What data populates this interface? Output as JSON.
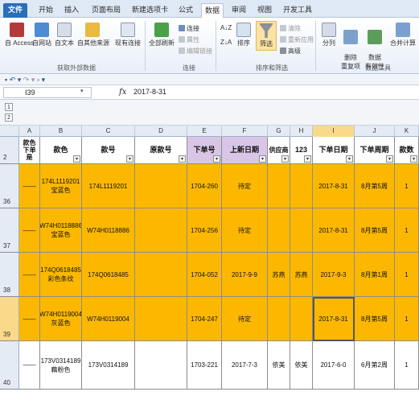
{
  "ribbon": {
    "tabs": [
      "文件",
      "开始",
      "插入",
      "页面布局",
      "新建选项卡",
      "公式",
      "数据",
      "审阅",
      "视图",
      "开发工具"
    ],
    "active_tab": "数据",
    "get_external": {
      "buttons": [
        "自 Access",
        "自网站",
        "自文本",
        "自其他来源",
        "现有连接"
      ],
      "label": "获取外部数据"
    },
    "connections": {
      "refresh": "全部刷新",
      "items": [
        "连接",
        "属性",
        "编辑链接"
      ],
      "label": "连接"
    },
    "sort_filter": {
      "sort": "排序",
      "filter": "筛选",
      "items": [
        "清除",
        "重新应用",
        "高级"
      ],
      "label": "排序和筛选"
    },
    "data_tools": {
      "buttons": [
        "分列",
        "删除\n重复项",
        "数据\n有效性",
        "合并计算"
      ],
      "label": "数据工具"
    }
  },
  "formula_bar": {
    "name_box": "I39",
    "fx": "fx",
    "value": "2017-8-31"
  },
  "outline_buttons": [
    "1",
    "2"
  ],
  "columns": [
    "A",
    "B",
    "C",
    "D",
    "E",
    "F",
    "G",
    "H",
    "I",
    "J",
    "K"
  ],
  "selected_column": "I",
  "header_row": {
    "row_number": "2",
    "cells": [
      "款色\n下单\n是",
      "款色",
      "款号",
      "原款号",
      "下单号",
      "上新日期",
      "供应商",
      "123",
      "下单日期",
      "下单周期",
      "款数"
    ]
  },
  "rows": [
    {
      "num": "36",
      "highlight": true,
      "cells": [
        "——",
        "174L1119201\n宝蓝色",
        "174L1119201",
        "",
        "1704-260",
        "待定",
        "",
        "",
        "2017-8-31",
        "8月第5周",
        "1"
      ]
    },
    {
      "num": "37",
      "highlight": true,
      "cells": [
        "——",
        "W74H0118886\n宝蓝色",
        "W74H0118886",
        "",
        "1704-256",
        "待定",
        "",
        "",
        "2017-8-31",
        "8月第5周",
        "1"
      ]
    },
    {
      "num": "38",
      "highlight": true,
      "cells": [
        "——",
        "174Q0618485\n彩色条纹",
        "174Q0618485",
        "",
        "1704-052",
        "2017-9-9",
        "苏燕",
        "苏燕",
        "2017-9-3",
        "8月第1周",
        "1"
      ]
    },
    {
      "num": "39",
      "highlight": true,
      "cells": [
        "——",
        "W74H0119004\n灰蓝色",
        "W74H0119004",
        "",
        "1704-247",
        "待定",
        "",
        "",
        "2017-8-31",
        "8月第5周",
        "1"
      ]
    },
    {
      "num": "40",
      "highlight": false,
      "cells": [
        "——",
        "173V0314189\n藕粉色",
        "173V0314189",
        "",
        "1703-221",
        "2017-7-3",
        "依美",
        "依美",
        "2017-6-0",
        "6月第2周",
        "1"
      ]
    }
  ],
  "selected_row": "39",
  "colors": {
    "highlight": "#fcb800",
    "header_purple": "#d9c6e6",
    "tab_file": "#2a6eb9"
  }
}
